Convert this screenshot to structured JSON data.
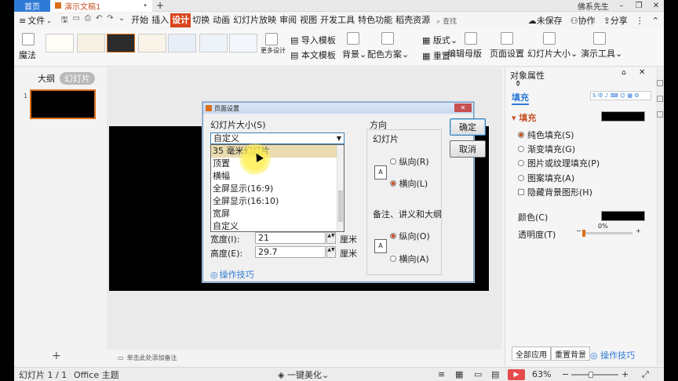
{
  "titlebar": {
    "home_tab": "首页",
    "doc_tab": "演示文稿1",
    "user": "佛系先生"
  },
  "menubar": {
    "file": "文件",
    "items": [
      "开始",
      "插入",
      "设计",
      "切换",
      "动画",
      "幻灯片放映",
      "审阅",
      "视图",
      "开发工具",
      "特色功能",
      "稻壳资源"
    ],
    "active": "设计",
    "search": "查找",
    "unsaved": "未保存",
    "collab": "协作",
    "share": "分享"
  },
  "ribbon": {
    "magic": "魔法",
    "more_design": "更多设计",
    "import_template": "导入模板",
    "text_template": "本文模板",
    "background": "背景",
    "color_scheme": "配色方案",
    "layout": "版式",
    "reset": "重置",
    "edit_master": "编辑母版",
    "page_setup": "页面设置",
    "slide_size": "幻灯片大小",
    "present_tool": "演示工具"
  },
  "leftpanel": {
    "tab_outline": "大纲",
    "tab_slides": "幻灯片",
    "thumb_number": "1",
    "add": "+"
  },
  "rightpanel": {
    "title": "对象属性",
    "tab_fill": "填充",
    "section_fill": "填充",
    "options": [
      "纯色填充(S)",
      "渐变填充(G)",
      "图片或纹理填充(P)",
      "图案填充(A)"
    ],
    "hide_bg": "隐藏背景图形(H)",
    "color_label": "颜色(C)",
    "transparency_label": "透明度(T)",
    "transparency_value": "0%",
    "apply_all": "全部应用",
    "reset_bg": "重置背景",
    "tips": "操作技巧",
    "colors": {
      "fill_swatch": "#000000"
    }
  },
  "notes": {
    "placeholder": "单击此处添加备注"
  },
  "statusbar": {
    "slide_info": "幻灯片 1 / 1",
    "theme": "Office 主题",
    "beautify": "一键美化",
    "zoom": "63%"
  },
  "dialog": {
    "title": "页面设置",
    "size_label": "幻灯片大小(S)",
    "size_selected": "自定义",
    "size_options": [
      "35 毫米幻灯片",
      "顶置",
      "横幅",
      "全屏显示(16:9)",
      "全屏显示(16:10)",
      "宽屏",
      "自定义"
    ],
    "width_label": "宽度(I):",
    "width_value": "21",
    "height_label": "高度(E):",
    "height_value": "29.7",
    "unit": "厘米",
    "orientation_label": "方向",
    "slides_label": "幻灯片",
    "portrait": "纵向(R)",
    "landscape": "横向(L)",
    "notes_label": "备注、讲义和大纲",
    "notes_portrait": "纵向(O)",
    "notes_landscape": "横向(A)",
    "ok": "确定",
    "cancel": "取消",
    "tips": "操作技巧"
  }
}
